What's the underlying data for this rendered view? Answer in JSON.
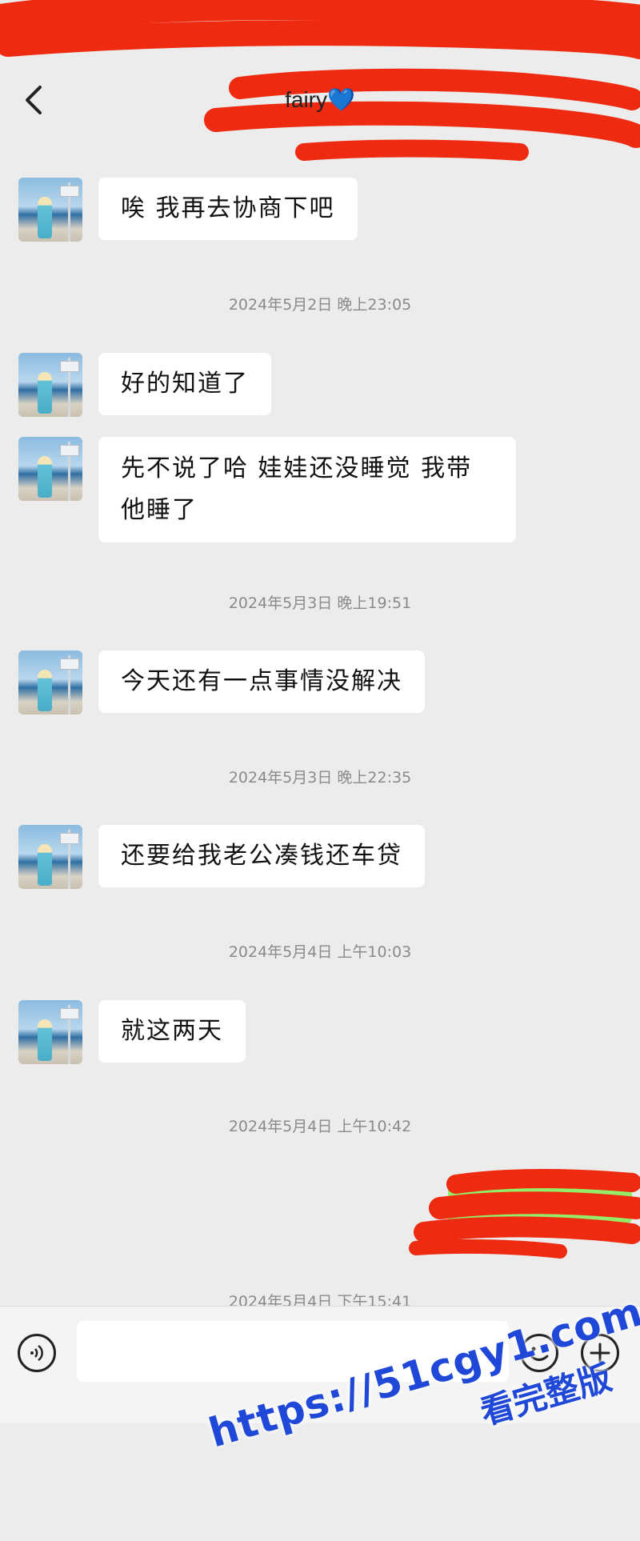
{
  "header": {
    "title": "fairy💙",
    "back_icon": "chevron-left-icon"
  },
  "messages": [
    {
      "type": "received",
      "text": "唉 我再去协商下吧"
    },
    {
      "type": "timestamp",
      "text": "2024年5月2日 晚上23:05"
    },
    {
      "type": "received",
      "text": "好的知道了"
    },
    {
      "type": "received",
      "text": "先不说了哈 娃娃还没睡觉 我带他睡了"
    },
    {
      "type": "timestamp",
      "text": "2024年5月3日 晚上19:51"
    },
    {
      "type": "received",
      "text": "今天还有一点事情没解决"
    },
    {
      "type": "timestamp",
      "text": "2024年5月3日 晚上22:35"
    },
    {
      "type": "received",
      "text": "还要给我老公凑钱还车贷"
    },
    {
      "type": "timestamp",
      "text": "2024年5月4日 上午10:03"
    },
    {
      "type": "received",
      "text": "就这两天"
    },
    {
      "type": "timestamp",
      "text": "2024年5月4日 上午10:42"
    },
    {
      "type": "timestamp",
      "text": "2024年5月4日 下午15:41"
    }
  ],
  "input_bar": {
    "voice_icon": "voice-icon",
    "message_value": "",
    "emoji_icon": "emoji-icon",
    "plus_icon": "plus-icon"
  },
  "watermark": {
    "url": "https://51cgy1.com",
    "text": "看完整版"
  },
  "colors": {
    "background": "#ececec",
    "bubble": "#ffffff",
    "redaction": "#ee2a10",
    "watermark": "#1f47d8"
  }
}
